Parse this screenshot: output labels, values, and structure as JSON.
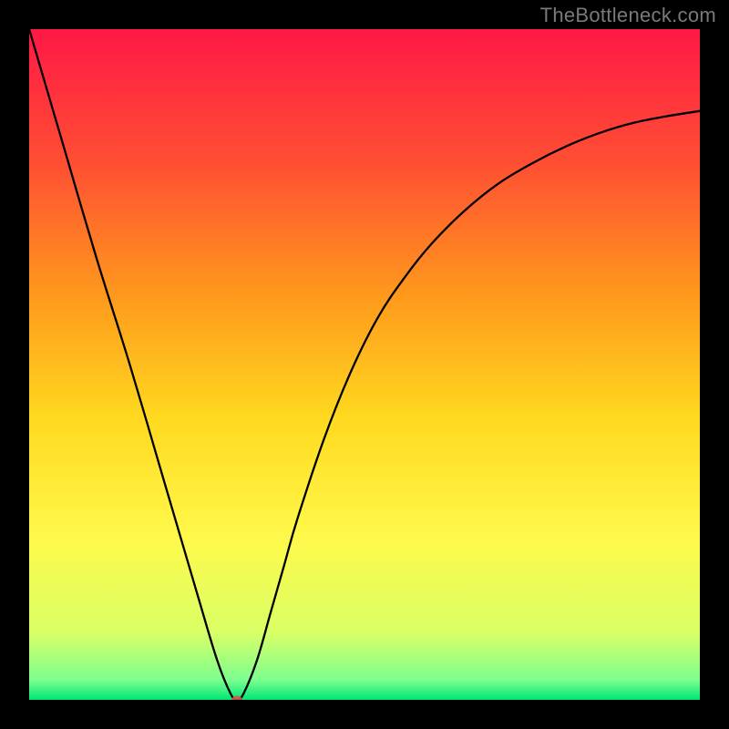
{
  "watermark": "TheBottleneck.com",
  "chart_data": {
    "type": "line",
    "title": "",
    "xlabel": "",
    "ylabel": "",
    "xlim": [
      0,
      100
    ],
    "ylim": [
      0,
      100
    ],
    "grid": false,
    "legend": false,
    "gradient_stops": [
      {
        "offset": 0.0,
        "color": "#ff1846"
      },
      {
        "offset": 0.2,
        "color": "#ff4f33"
      },
      {
        "offset": 0.4,
        "color": "#ff9a1c"
      },
      {
        "offset": 0.58,
        "color": "#ffd91f"
      },
      {
        "offset": 0.76,
        "color": "#fff94b"
      },
      {
        "offset": 0.9,
        "color": "#d9ff66"
      },
      {
        "offset": 0.97,
        "color": "#7dff8f"
      },
      {
        "offset": 1.0,
        "color": "#00e676"
      }
    ],
    "series": [
      {
        "name": "bottleneck-curve",
        "x": [
          0,
          5,
          10,
          15,
          20,
          25,
          28,
          30,
          31,
          32,
          34,
          36,
          38,
          40,
          44,
          48,
          52,
          56,
          60,
          65,
          70,
          75,
          80,
          85,
          90,
          95,
          100
        ],
        "values": [
          100,
          83,
          66,
          50,
          33,
          16,
          6,
          1,
          0,
          1,
          6,
          13,
          20,
          27,
          39,
          49,
          57,
          63,
          68,
          73,
          77,
          80,
          82.5,
          84.5,
          86,
          87,
          87.8
        ]
      }
    ],
    "marker": {
      "x": 31,
      "y": 0,
      "rx": 6,
      "ry": 4.5
    }
  }
}
